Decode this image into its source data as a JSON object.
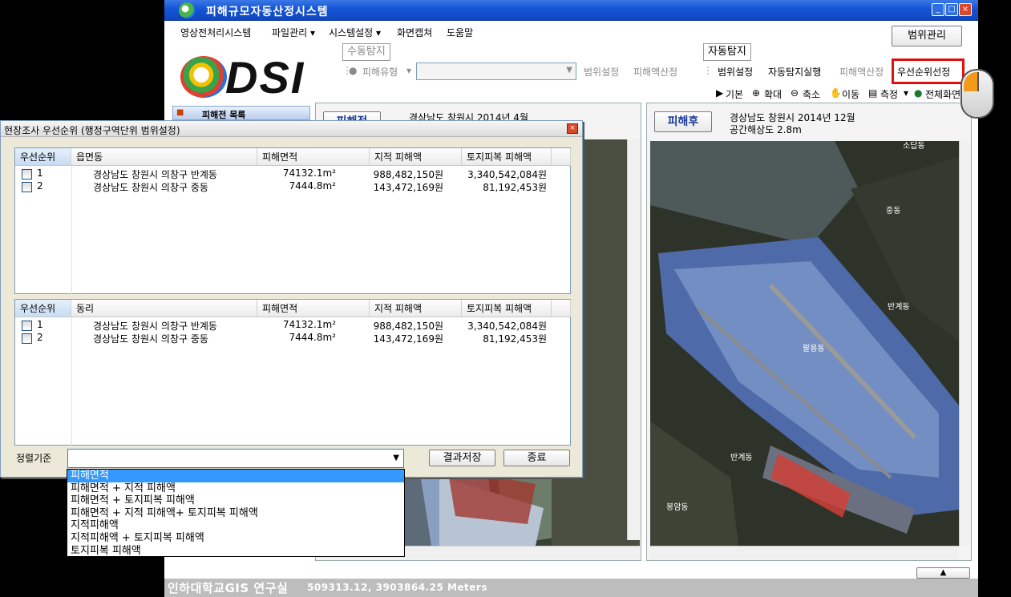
{
  "window": {
    "title": "피해규모자동산정시스템"
  },
  "menu": [
    "영상전처리시스템",
    "파일관리 ▾",
    "시스템설정 ▾",
    "화면캡쳐",
    "도움말"
  ],
  "range_manage_button": "범위관리",
  "logo_text": "DSI",
  "manual_group": {
    "label": "수동탐지",
    "damage_type": "피해유형",
    "range_setting": "범위설정",
    "damage_calc": "피해액산정"
  },
  "auto_group": {
    "label": "자동탐지",
    "range_setting": "범위설정",
    "run": "자동탐지실행",
    "damage_calc": "피해액산정",
    "priority": "우선순위선정"
  },
  "map_tools": [
    "기본",
    "확대",
    "축소",
    "이동",
    "측정",
    "전체화면"
  ],
  "left_panel": {
    "tab": "피해전 목록",
    "badge": "피해전",
    "location": "경상남도 창원시 2014년 4월"
  },
  "right_panel": {
    "badge": "피해후",
    "location": "경상남도 창원시 2014년 12월",
    "resolution": "공간해상도 2.8m",
    "map_labels": [
      "소답동",
      "중동",
      "반계동",
      "팔용동",
      "반계동",
      "봉암동"
    ]
  },
  "dialog": {
    "title": "현장조사 우선순위 (행정구역단위 범위설정)",
    "list1": {
      "headers": [
        "우선순위",
        "읍면동",
        "피해면적",
        "지적 피해액",
        "토지피복 피해액"
      ],
      "rows": [
        [
          "1",
          "경상남도 창원시 의창구 반계동",
          "74132.1m²",
          "988,482,150원",
          "3,340,542,084원"
        ],
        [
          "2",
          "경상남도 창원시 의창구 중동",
          "7444.8m²",
          "143,472,169원",
          "81,192,453원"
        ]
      ]
    },
    "list2": {
      "headers": [
        "우선순위",
        "동리",
        "피해면적",
        "지적 피해액",
        "토지피복 피해액"
      ],
      "rows": [
        [
          "1",
          "경상남도 창원시 의창구 반계동",
          "74132.1m²",
          "988,482,150원",
          "3,340,542,084원"
        ],
        [
          "2",
          "경상남도 창원시 의창구 중동",
          "7444.8m²",
          "143,472,169원",
          "81,192,453원"
        ]
      ]
    },
    "sort_label": "정렬기준",
    "save_button": "결과저장",
    "close_button": "종료",
    "sort_options": [
      "피해면적",
      "피해면적 + 지적 피해액",
      "피해면적 + 토지피복 피해액",
      "피해면적 + 지적 피해액+ 토지피복 피해액",
      "지적피해액",
      "지적피해액 + 토지피복 피해액",
      "토지피복 피해액"
    ],
    "selected_option": "피해면적"
  },
  "status": {
    "org": "인하대학교GIS 연구실",
    "coords": "509313.12, 3903864.25  Meters"
  }
}
